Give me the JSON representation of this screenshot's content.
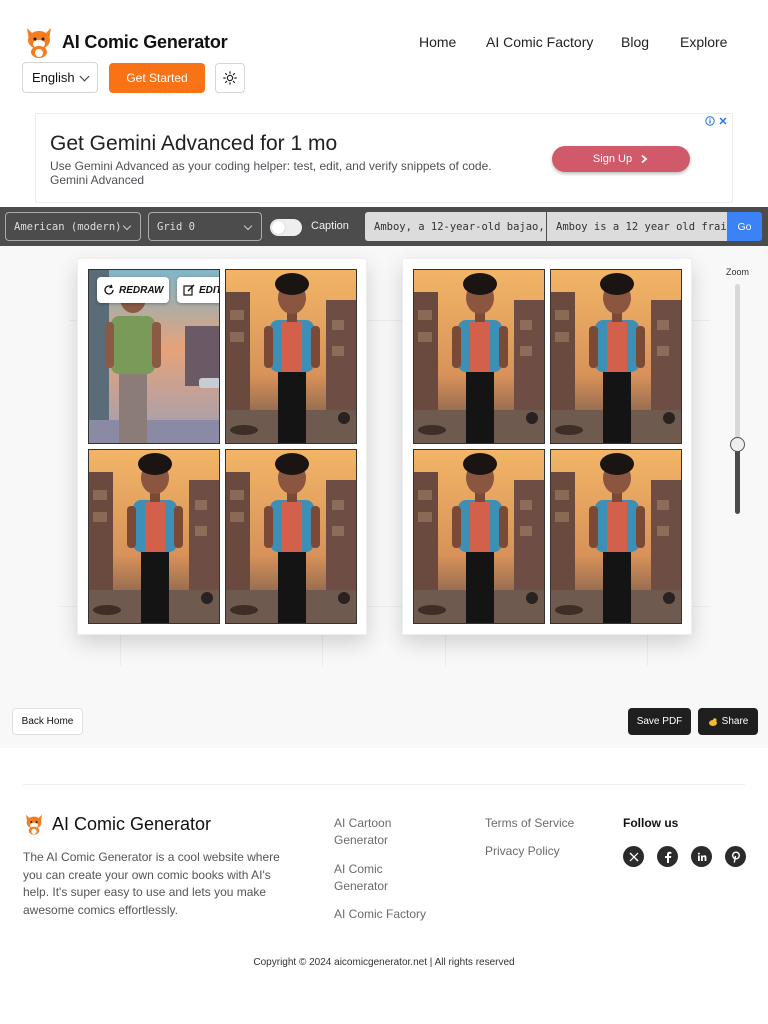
{
  "header": {
    "brand": "AI Comic Generator",
    "nav": [
      "Home",
      "AI Comic Factory",
      "Blog",
      "Explore"
    ],
    "language": "English",
    "get_started": "Get Started"
  },
  "ad": {
    "headline": "Get Gemini Advanced for 1 mo",
    "body": "Use Gemini Advanced as your coding helper: test, edit, and verify snippets of code.",
    "advertiser": "Gemini Advanced",
    "cta": "Sign Up"
  },
  "toolbar": {
    "style": "American (modern)",
    "layout": "Grid 0",
    "caption_label": "Caption",
    "caption_on": false,
    "prompt_1": "Amboy, a 12-year-old bajao,",
    "prompt_2": "Amboy is a 12 year old frai",
    "go": "Go"
  },
  "canvas": {
    "pages": [
      {
        "panels": [
          "panel-boy-street-sunset",
          "panel-boy-alley",
          "panel-boy-alley",
          "panel-boy-alley"
        ]
      },
      {
        "panels": [
          "panel-boy-alley",
          "panel-boy-alley",
          "panel-boy-alley",
          "panel-boy-alley"
        ]
      }
    ],
    "redraw": "REDRAW",
    "edit": "EDIT",
    "zoom_label": "Zoom",
    "zoom_level": 0.3
  },
  "actions": {
    "back_home": "Back Home",
    "save_pdf": "Save PDF",
    "share": "Share"
  },
  "footer": {
    "brand": "AI Comic Generator",
    "description": "The AI Comic Generator is a cool website where you can create your own comic books with AI's help. It's super easy to use and lets you make awesome comics effortlessly.",
    "col1": [
      "AI Cartoon Generator",
      "AI Comic Generator",
      "AI Comic Factory"
    ],
    "col2": [
      "Terms of Service",
      "Privacy Policy"
    ],
    "follow": "Follow us",
    "socials": [
      "x-icon",
      "facebook-icon",
      "linkedin-icon",
      "pinterest-icon"
    ],
    "copyright": "Copyright © 2024 aicomicgenerator.net | All rights reserved"
  },
  "colors": {
    "accent": "#f97316",
    "go": "#3b82f6",
    "toolbar": "#4c4c4c",
    "ad_cta": "#d05a69"
  }
}
